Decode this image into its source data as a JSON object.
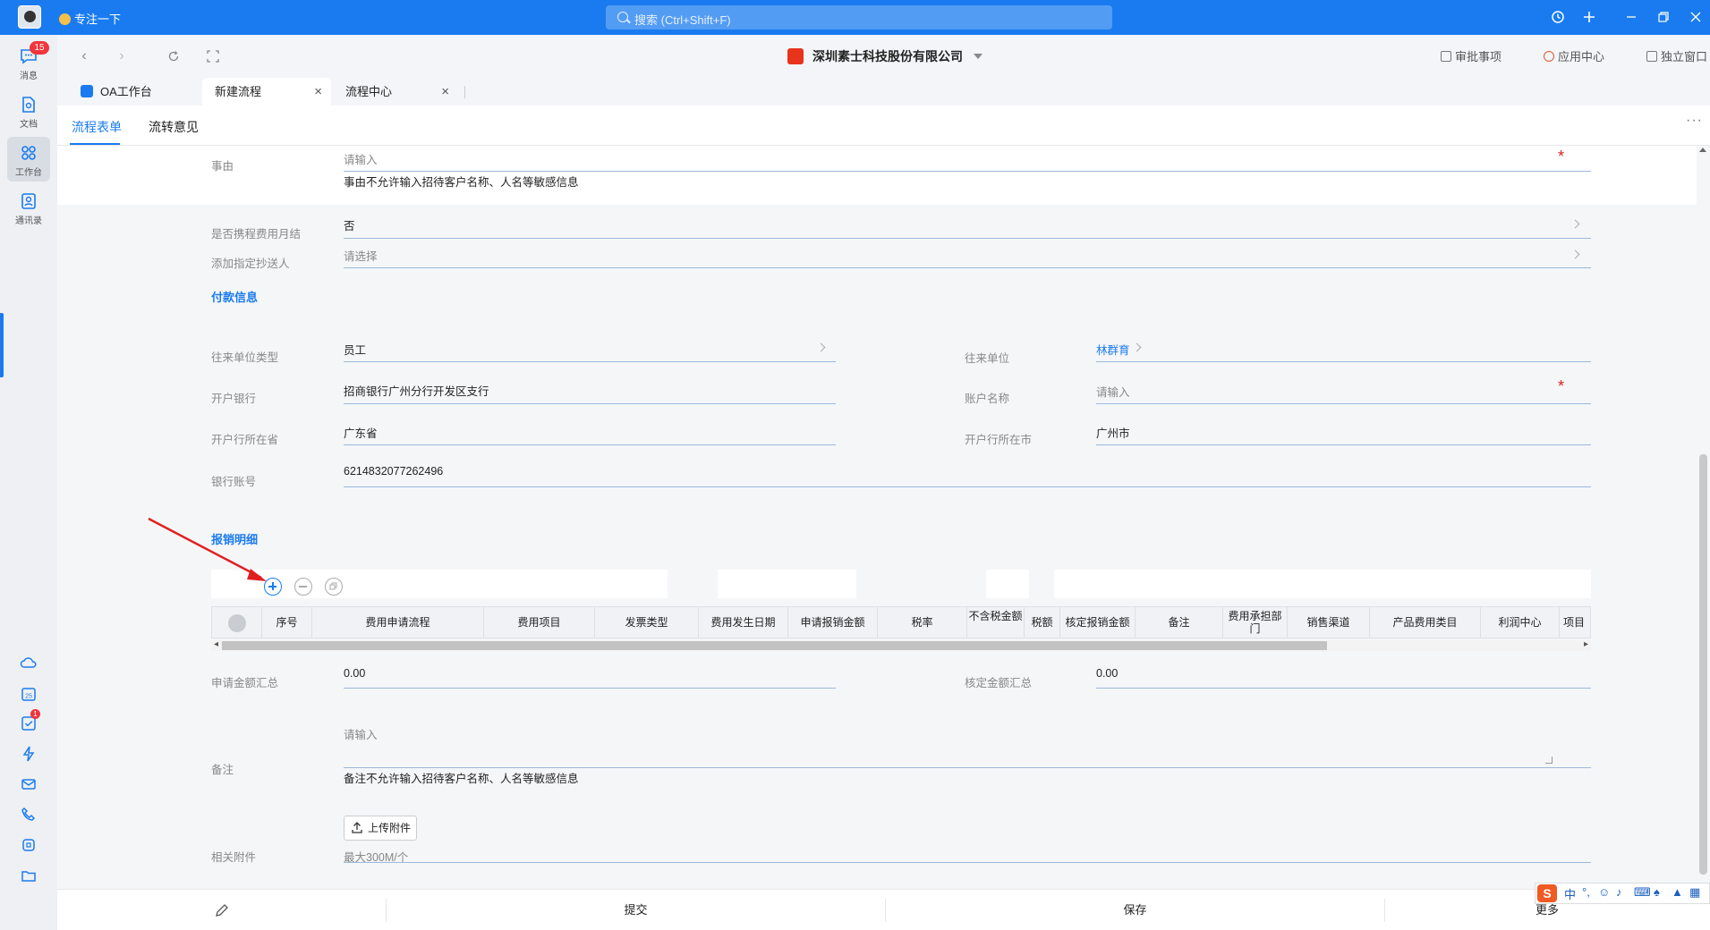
{
  "titlebar": {
    "focus_label": "专注一下",
    "search_placeholder": "搜索 (Ctrl+Shift+F)"
  },
  "rail": {
    "items": [
      {
        "label": "消息",
        "badge": "15",
        "icon": "chat-icon"
      },
      {
        "label": "文档",
        "icon": "document-icon"
      },
      {
        "label": "工作台",
        "icon": "grid-icon"
      },
      {
        "label": "通讯录",
        "icon": "contacts-icon"
      }
    ],
    "tool_icons": [
      "cloud-icon",
      "calendar-icon",
      "task-icon",
      "lightning-icon",
      "mail-icon",
      "phone-icon",
      "meeting-icon",
      "folder-icon"
    ],
    "calendar_text": "25",
    "task_badge": "1"
  },
  "nav": {
    "company": "深圳素士科技股份有限公司",
    "approval": "审批事项",
    "app_center": "应用中心",
    "detach": "独立窗口"
  },
  "tabs": [
    {
      "label": "OA工作台"
    },
    {
      "label": "新建流程"
    },
    {
      "label": "流程中心"
    }
  ],
  "formtabs": {
    "form": "流程表单",
    "comments": "流转意见"
  },
  "form": {
    "reason_label": "事由",
    "reason_placeholder": "请输入",
    "reason_hint": "事由不允许输入招待客户名称、人名等敏感信息",
    "monthly_label": "是否携程费用月结",
    "monthly_value": "否",
    "cc_label": "添加指定抄送人",
    "cc_placeholder": "请选择",
    "payment_title": "付款信息",
    "counterparty_type_label": "往来单位类型",
    "counterparty_type_value": "员工",
    "counterparty_label": "往来单位",
    "counterparty_value": "林群育",
    "bank_label": "开户银行",
    "bank_value": "招商银行广州分行开发区支行",
    "account_name_label": "账户名称",
    "account_name_placeholder": "请输入",
    "province_label": "开户行所在省",
    "province_value": "广东省",
    "city_label": "开户行所在市",
    "city_value": "广州市",
    "account_no_label": "银行账号",
    "account_no_value": "6214832077262496",
    "detail_title": "报销明细",
    "table_headers": [
      "序号",
      "费用申请流程",
      "费用项目",
      "发票类型",
      "费用发生日期",
      "申请报销金额",
      "税率",
      "不含税金额",
      "税额",
      "核定报销金额",
      "备注",
      "费用承担部门",
      "销售渠道",
      "产品费用类目",
      "利润中心",
      "项目"
    ],
    "apply_total_label": "申请金额汇总",
    "apply_total_value": "0.00",
    "approved_total_label": "核定金额汇总",
    "approved_total_value": "0.00",
    "remark_label": "备注",
    "remark_placeholder": "请输入",
    "remark_hint": "备注不允许输入招待客户名称、人名等敏感信息",
    "upload_label": "上传附件",
    "attachment_label": "相关附件",
    "attachment_hint": "最大300M/个"
  },
  "actions": {
    "submit": "提交",
    "save": "保存",
    "more": "更多"
  },
  "ime": {
    "logo": "S",
    "mode": "中",
    "punct": "°,"
  },
  "colors": {
    "brand": "#1a7bf0",
    "required": "#e02020",
    "badge": "#f0353b",
    "annotation": "#e02020"
  }
}
